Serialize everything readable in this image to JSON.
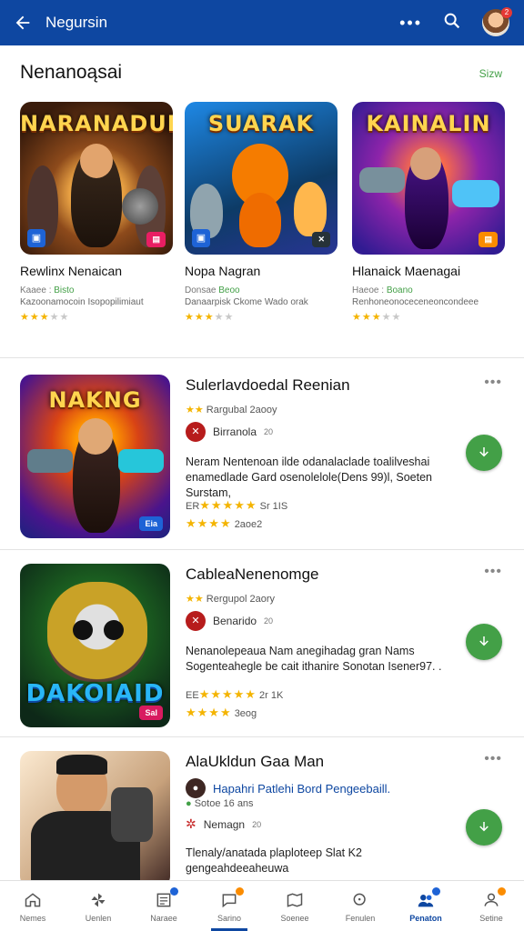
{
  "topbar": {
    "title": "Negursin",
    "avatar_badge": "2"
  },
  "featured": {
    "heading": "Nenanoąsai",
    "see_all": "Sizw",
    "cards": [
      {
        "art_title": "NARANADUN",
        "name": "Rewlinx Nenaican",
        "meta_left": "Kaaee :",
        "meta_green": "Bisto",
        "desc": "Kazoonamocoin Isopopilimiaut",
        "tag": "",
        "stars_on": "★★★",
        "stars_off": "★★"
      },
      {
        "art_title": "SUARAK",
        "name": "Nopa Nagran",
        "meta_left": "Donsae",
        "meta_green": "Beoo",
        "desc": "Danaarpisk Ckome Wado orak",
        "tag": "",
        "stars_on": "★★★",
        "stars_off": "★★"
      },
      {
        "art_title": "KAINALIN",
        "name": "Hlanaick Maenagai",
        "meta_left": "Haeoe :",
        "meta_green": "Boano",
        "desc": "Renhoneonoceceneoncondeee",
        "tag": "",
        "stars_on": "★★★",
        "stars_off": "★★"
      }
    ]
  },
  "items": [
    {
      "art_title": "NAKNG",
      "title": "Sulerlavdoedal Reenian",
      "rating_label": "Rargubal",
      "rating_value": "2aooy",
      "developer": "Birranola",
      "dev_count": "20",
      "desc": "Neram Nentenoan ilde odanalaclade toalilveshai enamedlade Gard osenolelole(Dens 99)l, Soeten Surstam,",
      "stars_a_label": "ER",
      "stars_a_text": "Sr 1IS",
      "stars_b_text": "2aoe2",
      "tag": "Eia"
    },
    {
      "art_title": "DAKOIAID",
      "title": "CableaNenenomge",
      "rating_label": "Rergupol",
      "rating_value": "2aory",
      "developer": "Benarido",
      "dev_count": "20",
      "desc": "Nenanolepeaua Nam anegihadag gran Nams Sogenteahegle be cait ithanire Sonotan Isener97. .",
      "stars_a_label": "EE",
      "stars_a_text": "2r 1K",
      "stars_b_text": "3eog",
      "tag": "Sal"
    },
    {
      "art_title": "",
      "title": "AlaUkldun Gaa Man",
      "rating_label": "Hapahri Patlehi Bord Pengeebaill.",
      "rating_value": "",
      "developer": "Nemagn",
      "dev_count": "20",
      "sub_meta": "Sotoe 16 ans",
      "desc": "Tlenaly/anatada plaploteep Slat K2 gengeahdeeaheuwa",
      "stars_a_label": "",
      "stars_a_text": "",
      "stars_b_text": "",
      "tag": ""
    }
  ],
  "bottom_nav": [
    {
      "label": "Nemes",
      "icon": "home-icon"
    },
    {
      "label": "Uenlen",
      "icon": "pinwheel-icon"
    },
    {
      "label": "Naraee",
      "icon": "news-icon"
    },
    {
      "label": "Sarino",
      "icon": "chat-icon"
    },
    {
      "label": "Soenee",
      "icon": "map-icon"
    },
    {
      "label": "Fenulen",
      "icon": "search-icon"
    },
    {
      "label": "Penaton",
      "icon": "people-icon"
    },
    {
      "label": "Setine",
      "icon": "profile-icon"
    }
  ],
  "colors": {
    "brand": "#0e47a1",
    "accent": "#43a047",
    "star": "#f4b400"
  }
}
